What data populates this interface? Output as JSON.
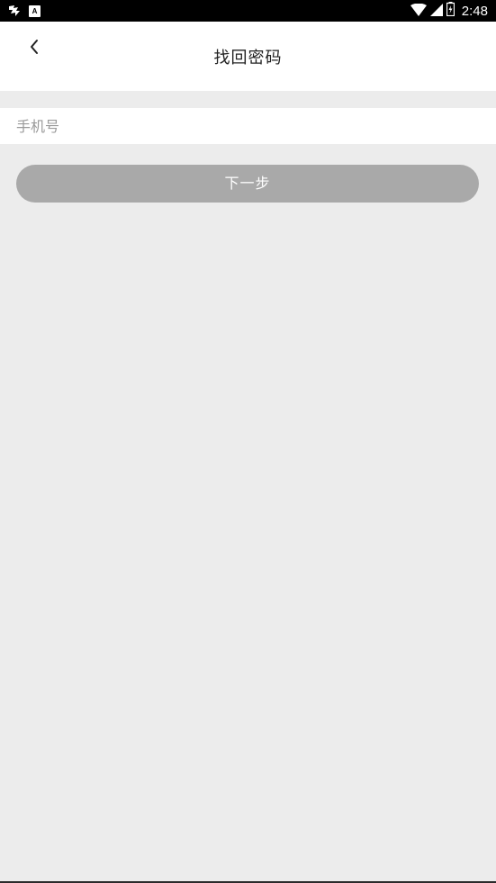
{
  "status_bar": {
    "time": "2:48",
    "left_icons": [
      "app-notification-icon",
      "a-notification-icon"
    ],
    "a_icon_letter": "A",
    "right_icons": [
      "wifi-icon",
      "signal-icon",
      "battery-icon"
    ]
  },
  "header": {
    "title": "找回密码",
    "back_icon": "chevron-left-icon"
  },
  "form": {
    "phone_placeholder": "手机号",
    "phone_value": ""
  },
  "actions": {
    "next_label": "下一步"
  },
  "colors": {
    "background": "#ececec",
    "header_bg": "#ffffff",
    "button_disabled": "#a9a9a9",
    "placeholder": "#9a9a9a"
  }
}
